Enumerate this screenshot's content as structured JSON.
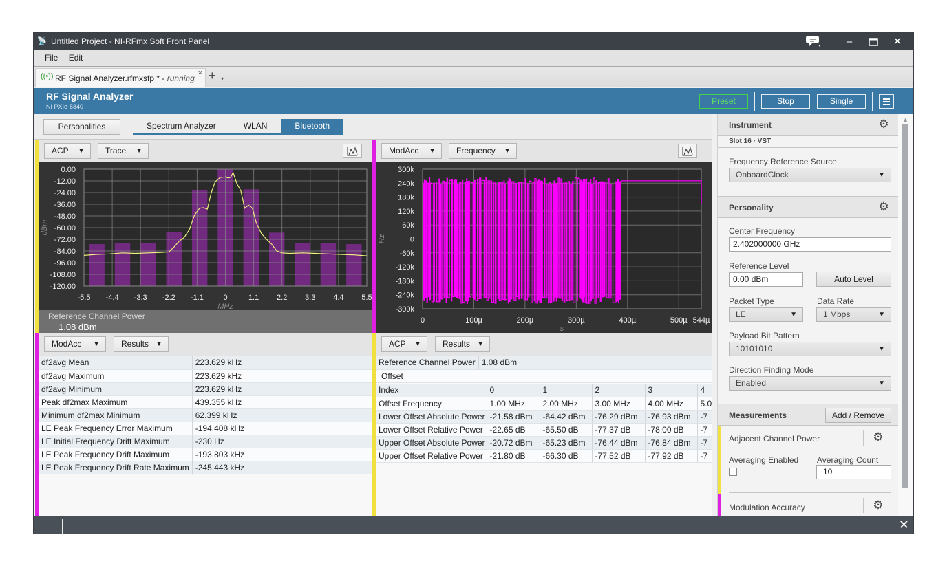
{
  "window": {
    "title": "Untitled Project - NI-RFmx Soft Front Panel",
    "app_icon": "antenna-icon",
    "controls": {
      "feedback": "💬",
      "minimize": "–",
      "maximize": "☐",
      "close": "✕"
    }
  },
  "menu": {
    "items": [
      "File",
      "Edit"
    ]
  },
  "document_tab": {
    "label": "RF Signal Analyzer.rfmxsfp * - ",
    "status": "running",
    "close": "×",
    "new_tab": "+",
    "new_tab_dropdown": "▾"
  },
  "header": {
    "title": "RF Signal Analyzer",
    "device": "NI PXIe-5840",
    "buttons": {
      "preset": "Preset",
      "stop": "Stop",
      "single": "Single"
    },
    "colors": {
      "bar": "#3a79a6",
      "preset": "#43d04a"
    }
  },
  "personalities": {
    "button": "Personalities",
    "tabs": [
      "Spectrum Analyzer",
      "WLAN",
      "Bluetooth"
    ],
    "active_tab": "Bluetooth"
  },
  "panels": {
    "top_left": {
      "measurement": "ACP",
      "view": "Trace",
      "edge_color": "#f0e040"
    },
    "top_right": {
      "measurement": "ModAcc",
      "view": "Frequency",
      "edge_color": "#e020e0"
    },
    "bottom_left": {
      "measurement": "ModAcc",
      "view": "Results",
      "edge_color": "#e020e0"
    },
    "bottom_right": {
      "measurement": "ACP",
      "view": "Results",
      "edge_color": "#f0e040"
    }
  },
  "chart_data": [
    {
      "type": "bar",
      "title": "ACP Trace",
      "xlabel": "MHz",
      "ylabel": "dBm",
      "xlim": [
        -5.5,
        5.5
      ],
      "ylim": [
        -120,
        0
      ],
      "grid": true,
      "x_ticks": [
        "-5.5",
        "-4.4",
        "-3.3",
        "-2.2",
        "-1.1",
        "0",
        "1.1",
        "2.2",
        "3.3",
        "4.4",
        "5.5"
      ],
      "y_ticks": [
        "0.00",
        "-12.00",
        "-24.00",
        "-36.00",
        "-48.00",
        "-60.00",
        "-72.00",
        "-84.00",
        "-96.00",
        "-108.00",
        "-120.00"
      ],
      "series": [
        {
          "name": "Channel Power",
          "kind": "bar",
          "color": "#7a2a8a",
          "x": [
            -5,
            -4,
            -3,
            -2,
            -1,
            0,
            1,
            2,
            3,
            4,
            5
          ],
          "values": [
            -77.0,
            -76.0,
            -75.5,
            -64.5,
            -21.5,
            0.0,
            -20.7,
            -65.2,
            -75.5,
            -76.0,
            -77.0
          ]
        },
        {
          "name": "Spectrum",
          "kind": "line",
          "color": "#f0f080",
          "x": [
            -5.5,
            -5.0,
            -4.5,
            -4.0,
            -3.5,
            -3.0,
            -2.5,
            -2.2,
            -2.0,
            -1.8,
            -1.6,
            -1.4,
            -1.2,
            -1.0,
            -0.85,
            -0.7,
            -0.55,
            -0.4,
            -0.2,
            0.0,
            0.1,
            0.2,
            0.3,
            0.45,
            0.6,
            0.75,
            0.9,
            1.05,
            1.2,
            1.4,
            1.6,
            1.8,
            2.0,
            2.2,
            2.5,
            3.0,
            3.5,
            4.0,
            4.5,
            5.0,
            5.5
          ],
          "values": [
            -88.5,
            -87.5,
            -87.0,
            -86.0,
            -86.5,
            -86.0,
            -85.5,
            -85.0,
            -80.0,
            -74.0,
            -70.0,
            -62.0,
            -47.0,
            -40.0,
            -39.5,
            -41.0,
            -24.0,
            -13.0,
            -8.5,
            -8.0,
            -9.0,
            -8.5,
            -3.5,
            -15.0,
            -22.0,
            -40.0,
            -37.0,
            -40.0,
            -55.0,
            -66.0,
            -72.0,
            -77.0,
            -84.0,
            -86.0,
            -86.5,
            -86.0,
            -86.5,
            -87.0,
            -87.5,
            -88.0,
            -89.0
          ]
        }
      ],
      "footer": {
        "label": "Reference Channel Power",
        "value": "1.08 dBm"
      }
    },
    {
      "type": "line",
      "title": "ModAcc Frequency",
      "xlabel": "s",
      "ylabel": "Hz",
      "xlim": [
        0,
        0.000544
      ],
      "ylim": [
        -300000,
        300000
      ],
      "grid": true,
      "x_ticks": [
        "0",
        "100µ",
        "200µ",
        "300µ",
        "400µ",
        "500µ",
        "544µ"
      ],
      "y_ticks": [
        "300k",
        "240k",
        "180k",
        "120k",
        "60k",
        "0",
        "-60k",
        "-120k",
        "-180k",
        "-240k",
        "-300k"
      ],
      "series": [
        {
          "name": "Frequency Deviation",
          "color": "#ff00ff",
          "description": "GFSK frequency deviation toggling between approx +250 kHz and -260 kHz from 0 to ~388 µs, then constant ~+250 kHz until 544 µs, dropping to ~+150 kHz at end",
          "modulated_until_us": 388,
          "high_hz": 250000,
          "low_hz": -262000,
          "tail_hz": 250000,
          "end_hz": 150000
        }
      ]
    }
  ],
  "modacc_results": {
    "rows": [
      {
        "label": "df2avg Mean",
        "value": "223.629 kHz"
      },
      {
        "label": "df2avg Maximum",
        "value": "223.629 kHz"
      },
      {
        "label": "df2avg Minimum",
        "value": "223.629 kHz"
      },
      {
        "label": "Peak df2max Maximum",
        "value": "439.355 kHz"
      },
      {
        "label": "Minimum df2max Minimum",
        "value": "62.399 kHz"
      },
      {
        "label": "LE Peak Frequency Error Maximum",
        "value": "-194.408 kHz"
      },
      {
        "label": "LE Initial Frequency Drift Maximum",
        "value": "-230 Hz"
      },
      {
        "label": "LE Peak Frequency Drift Maximum",
        "value": "-193.803 kHz"
      },
      {
        "label": "LE Peak Frequency Drift Rate Maximum",
        "value": "-245.443 kHz"
      }
    ]
  },
  "acp_results": {
    "ref_label": "Reference Channel Power",
    "ref_value": "1.08 dBm",
    "offset_header": "Offset",
    "rows": [
      {
        "label": "Index",
        "cells": [
          "0",
          "1",
          "2",
          "3",
          "4"
        ]
      },
      {
        "label": "Offset Frequency",
        "cells": [
          "1.00 MHz",
          "2.00 MHz",
          "3.00 MHz",
          "4.00 MHz",
          "5.0"
        ]
      },
      {
        "label": "Lower Offset Absolute Power",
        "cells": [
          "-21.58 dBm",
          "-64.42 dBm",
          "-76.29 dBm",
          "-76.93 dBm",
          "-7"
        ]
      },
      {
        "label": "Lower Offset Relative Power",
        "cells": [
          "-22.65 dB",
          "-65.50 dB",
          "-77.37 dB",
          "-78.00 dB",
          "-7"
        ]
      },
      {
        "label": "Upper Offset Absolute Power",
        "cells": [
          "-20.72 dBm",
          "-65.23 dBm",
          "-76.44 dBm",
          "-76.84 dBm",
          "-7"
        ]
      },
      {
        "label": "Upper Offset Relative Power",
        "cells": [
          "-21.80 dB",
          "-66.30 dB",
          "-77.52 dB",
          "-77.92 dB",
          "-7"
        ]
      }
    ]
  },
  "settings": {
    "instrument": {
      "title": "Instrument",
      "slot": "Slot 16 · VST",
      "freq_ref_label": "Frequency Reference Source",
      "freq_ref_value": "OnboardClock"
    },
    "personality": {
      "title": "Personality",
      "center_freq_label": "Center Frequency",
      "center_freq_value": "2.402000000 GHz",
      "ref_level_label": "Reference Level",
      "ref_level_value": "0.00 dBm",
      "auto_level": "Auto Level",
      "packet_type_label": "Packet Type",
      "packet_type_value": "LE",
      "data_rate_label": "Data Rate",
      "data_rate_value": "1 Mbps",
      "payload_label": "Payload Bit Pattern",
      "payload_value": "10101010",
      "df_mode_label": "Direction Finding Mode",
      "df_mode_value": "Enabled"
    },
    "measurements": {
      "title": "Measurements",
      "add_remove": "Add / Remove",
      "acp": {
        "title": "Adjacent Channel Power",
        "avg_enabled_label": "Averaging Enabled",
        "avg_enabled": false,
        "avg_count_label": "Averaging Count",
        "avg_count_value": "10"
      },
      "modacc": {
        "title": "Modulation Accuracy"
      }
    },
    "gear_icon": "⚙",
    "dropdown_arrow": "▼"
  },
  "statusbar": {
    "close": "✕"
  }
}
